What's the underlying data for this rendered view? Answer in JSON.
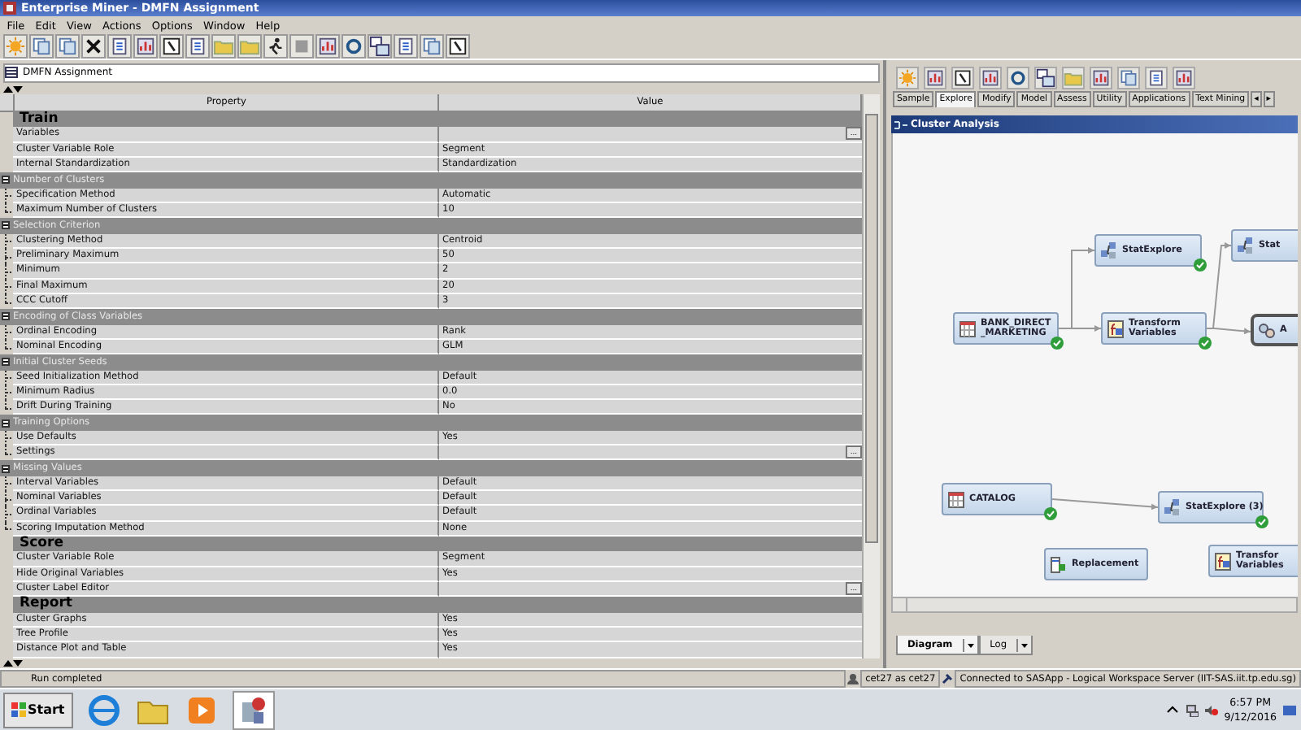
{
  "window": {
    "title": "Enterprise Miner - DMFN Assignment"
  },
  "menu": [
    "File",
    "Edit",
    "View",
    "Actions",
    "Options",
    "Window",
    "Help"
  ],
  "project_tab": {
    "title": "DMFN Assignment"
  },
  "property_table": {
    "columns": [
      "Property",
      "Value"
    ],
    "sections": [
      {
        "title": "Train",
        "rows": [
          {
            "kind": "item",
            "property": "Variables",
            "button": "..."
          },
          {
            "kind": "item",
            "property": "Cluster Variable Role",
            "value": "Segment"
          },
          {
            "kind": "item",
            "property": "Internal Standardization",
            "value": "Standardization"
          },
          {
            "kind": "group",
            "label": "Number of Clusters",
            "expanded": true,
            "children": [
              {
                "property": "Specification Method",
                "value": "Automatic"
              },
              {
                "property": "Maximum Number of Clusters",
                "value": "10"
              }
            ]
          },
          {
            "kind": "group",
            "label": "Selection Criterion",
            "expanded": true,
            "children": [
              {
                "property": "Clustering Method",
                "value": "Centroid"
              },
              {
                "property": "Preliminary Maximum",
                "value": "50"
              },
              {
                "property": "Minimum",
                "value": "2"
              },
              {
                "property": "Final Maximum",
                "value": "20"
              },
              {
                "property": "CCC Cutoff",
                "value": "3"
              }
            ]
          },
          {
            "kind": "group",
            "label": "Encoding of Class Variables",
            "expanded": true,
            "children": [
              {
                "property": "Ordinal Encoding",
                "value": "Rank"
              },
              {
                "property": "Nominal Encoding",
                "value": "GLM"
              }
            ]
          },
          {
            "kind": "group",
            "label": "Initial Cluster Seeds",
            "expanded": true,
            "children": [
              {
                "property": "Seed Initialization Method",
                "value": "Default"
              },
              {
                "property": "Minimum Radius",
                "value": "0.0"
              },
              {
                "property": "Drift During Training",
                "value": "No"
              }
            ]
          },
          {
            "kind": "group",
            "label": "Training Options",
            "expanded": true,
            "children": [
              {
                "property": "Use Defaults",
                "value": "Yes"
              },
              {
                "property": "Settings",
                "button": "..."
              }
            ]
          },
          {
            "kind": "group",
            "label": "Missing Values",
            "expanded": true,
            "children": [
              {
                "property": "Interval Variables",
                "value": "Default"
              },
              {
                "property": "Nominal Variables",
                "value": "Default"
              },
              {
                "property": "Ordinal Variables",
                "value": "Default"
              },
              {
                "property": "Scoring Imputation Method",
                "value": "None"
              }
            ]
          }
        ]
      },
      {
        "title": "Score",
        "rows": [
          {
            "kind": "item",
            "property": "Cluster Variable Role",
            "value": "Segment"
          },
          {
            "kind": "item",
            "property": "Hide Original Variables",
            "value": "Yes"
          },
          {
            "kind": "item",
            "property": "Cluster Label Editor",
            "button": "..."
          }
        ]
      },
      {
        "title": "Report",
        "rows": [
          {
            "kind": "item",
            "property": "Cluster Graphs",
            "value": "Yes"
          },
          {
            "kind": "item",
            "property": "Tree Profile",
            "value": "Yes"
          },
          {
            "kind": "item",
            "property": "Distance Plot and Table",
            "value": "Yes"
          }
        ]
      }
    ]
  },
  "node_palette": {
    "tabs": [
      {
        "label": "Sample",
        "selected": false
      },
      {
        "label": "Explore",
        "selected": true
      },
      {
        "label": "Modify",
        "selected": false
      },
      {
        "label": "Model",
        "selected": false
      },
      {
        "label": "Assess",
        "selected": false
      },
      {
        "label": "Utility",
        "selected": false
      },
      {
        "label": "Applications",
        "selected": false
      },
      {
        "label": "Text Mining",
        "selected": false
      }
    ],
    "scroll_left": "◂",
    "scroll_right": "▸"
  },
  "diagram": {
    "title": "Cluster Analysis",
    "nodes": [
      {
        "kind": "data",
        "label": [
          "BANK_DIRECT",
          "_MARKETING"
        ],
        "completed": true,
        "selected": false
      },
      {
        "kind": "explore",
        "label": [
          "StatExplore"
        ],
        "completed": true,
        "selected": false
      },
      {
        "kind": "transform",
        "label": [
          "Transform",
          "Variables"
        ],
        "completed": true,
        "selected": false
      },
      {
        "kind": "explore",
        "label": [
          "Stat"
        ],
        "completed": false,
        "selected": false
      },
      {
        "kind": "cluster",
        "label": [
          "A"
        ],
        "completed": false,
        "selected": true
      },
      {
        "kind": "data",
        "label": [
          "CATALOG"
        ],
        "completed": true,
        "selected": false
      },
      {
        "kind": "explore",
        "label": [
          "StatExplore (3)"
        ],
        "completed": true,
        "selected": false
      },
      {
        "kind": "replacement",
        "label": [
          "Replacement"
        ],
        "completed": false,
        "selected": false
      },
      {
        "kind": "transform",
        "label": [
          "Transfor",
          "Variables"
        ],
        "completed": false,
        "selected": false
      }
    ],
    "bottom_tabs": [
      {
        "label": "Diagram",
        "selected": true
      },
      {
        "label": "Log",
        "selected": false
      }
    ]
  },
  "status_bar": {
    "message": "Run completed",
    "user": "cet27 as cet27",
    "connection": "Connected to SASApp - Logical Workspace Server (IIT-SAS.iit.tp.edu.sg)"
  },
  "taskbar": {
    "start": "Start",
    "time": "6:57 PM",
    "date": "9/12/2016"
  }
}
